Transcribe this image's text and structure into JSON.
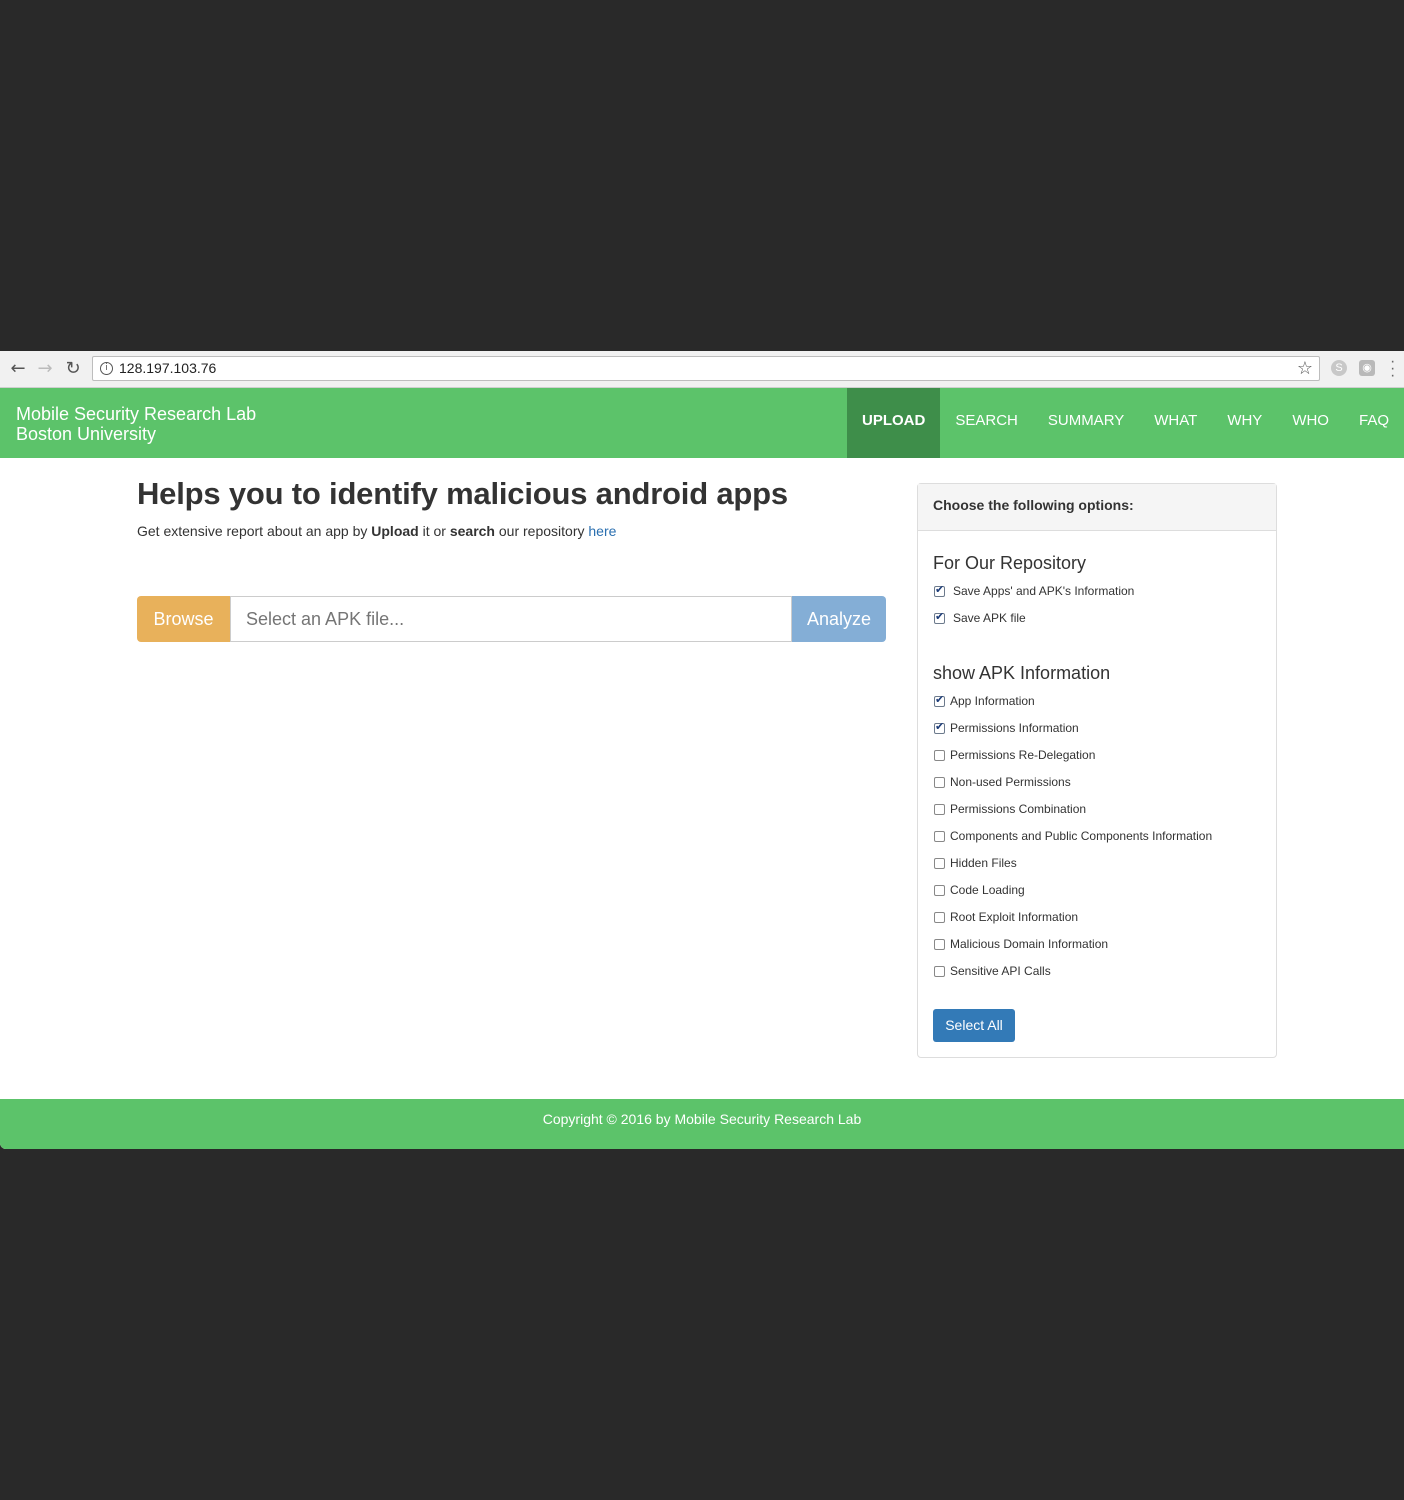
{
  "browser": {
    "url": "128.197.103.76",
    "back_icon": "←",
    "forward_icon": "→",
    "reload_icon": "↻",
    "info_icon": "i",
    "star_icon": "☆",
    "menu_icon": "⋮"
  },
  "navbar": {
    "brand_line1": "Mobile Security Research Lab",
    "brand_line2": "Boston University",
    "items": [
      "UPLOAD",
      "SEARCH",
      "SUMMARY",
      "WHAT",
      "WHY",
      "WHO",
      "FAQ"
    ],
    "active": "UPLOAD"
  },
  "main": {
    "headline": "Helps you to identify malicious android apps",
    "intro_part1": "Get extensive report about an app by ",
    "intro_bold1": "Upload",
    "intro_part2": " it or ",
    "intro_bold2": "search",
    "intro_part3": " our repository ",
    "intro_link": "here",
    "browse_label": "Browse",
    "file_placeholder": "Select an APK file...",
    "analyze_label": "Analyze"
  },
  "options": {
    "header": "Choose the following options:",
    "repo_title": "For Our Repository",
    "repo_items": [
      {
        "label": "Save Apps' and APK's Information",
        "checked": true
      },
      {
        "label": "Save APK file",
        "checked": true
      }
    ],
    "apk_title": "show APK Information",
    "apk_items": [
      {
        "label": "App Information",
        "checked": true
      },
      {
        "label": "Permissions Information",
        "checked": true
      },
      {
        "label": "Permissions Re-Delegation",
        "checked": false
      },
      {
        "label": "Non-used Permissions",
        "checked": false
      },
      {
        "label": "Permissions Combination",
        "checked": false
      },
      {
        "label": "Components and Public Components Information",
        "checked": false
      },
      {
        "label": "Hidden Files",
        "checked": false
      },
      {
        "label": "Code Loading",
        "checked": false
      },
      {
        "label": "Root Exploit Information",
        "checked": false
      },
      {
        "label": "Malicious Domain Information",
        "checked": false
      },
      {
        "label": "Sensitive API Calls",
        "checked": false
      }
    ],
    "select_all_label": "Select All"
  },
  "footer": {
    "text": "Copyright © 2016 by Mobile Security Research Lab"
  },
  "colors": {
    "brand_green": "#5cc36a",
    "active_nav": "#3e8e4a",
    "browse": "#e8b15b",
    "analyze": "#84aed6",
    "select_all": "#337ab7",
    "backdrop": "#292929"
  }
}
